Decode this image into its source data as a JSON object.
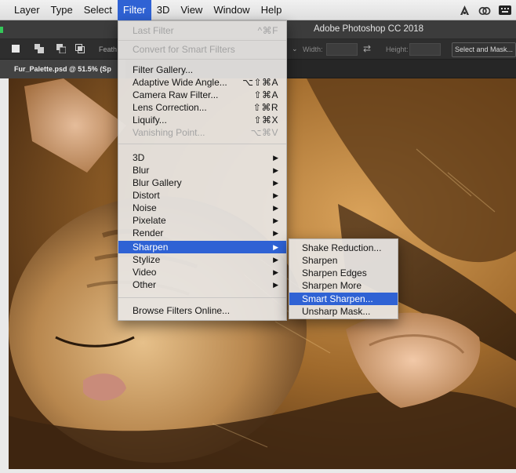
{
  "menubar": {
    "items": [
      "Layer",
      "Type",
      "Select",
      "Filter",
      "3D",
      "View",
      "Window",
      "Help"
    ],
    "active_item": "Filter",
    "active_color": "#2f62d4",
    "tray_icons": [
      "adobe-cc-icon",
      "creative-cloud-icon",
      "keyboard-icon"
    ]
  },
  "app": {
    "title": "Adobe Photoshop CC 2018"
  },
  "options_bar": {
    "feather_label": "Feath",
    "width_label": "Width:",
    "height_label": "Height:",
    "select_and_mask_label": "Select and Mask..."
  },
  "document": {
    "tab_title": "Fur_Palette.psd @ 51.5% (Sp"
  },
  "filter_menu": {
    "last_filter": {
      "label": "Last Filter",
      "shortcut": "^⌘F"
    },
    "convert": {
      "label": "Convert for Smart Filters"
    },
    "group1": [
      {
        "label": "Filter Gallery...",
        "shortcut": ""
      },
      {
        "label": "Adaptive Wide Angle...",
        "shortcut": "⌥⇧⌘A"
      },
      {
        "label": "Camera Raw Filter...",
        "shortcut": "⇧⌘A"
      },
      {
        "label": "Lens Correction...",
        "shortcut": "⇧⌘R"
      },
      {
        "label": "Liquify...",
        "shortcut": "⇧⌘X"
      },
      {
        "label": "Vanishing Point...",
        "shortcut": "⌥⌘V"
      }
    ],
    "group2": [
      "3D",
      "Blur",
      "Blur Gallery",
      "Distort",
      "Noise",
      "Pixelate",
      "Render",
      "Sharpen",
      "Stylize",
      "Video",
      "Other"
    ],
    "highlighted": "Sharpen",
    "browse": "Browse Filters Online..."
  },
  "sharpen_submenu": {
    "items": [
      "Shake Reduction...",
      "Sharpen",
      "Sharpen Edges",
      "Sharpen More",
      "Smart Sharpen...",
      "Unsharp Mask..."
    ],
    "highlighted": "Smart Sharpen..."
  }
}
